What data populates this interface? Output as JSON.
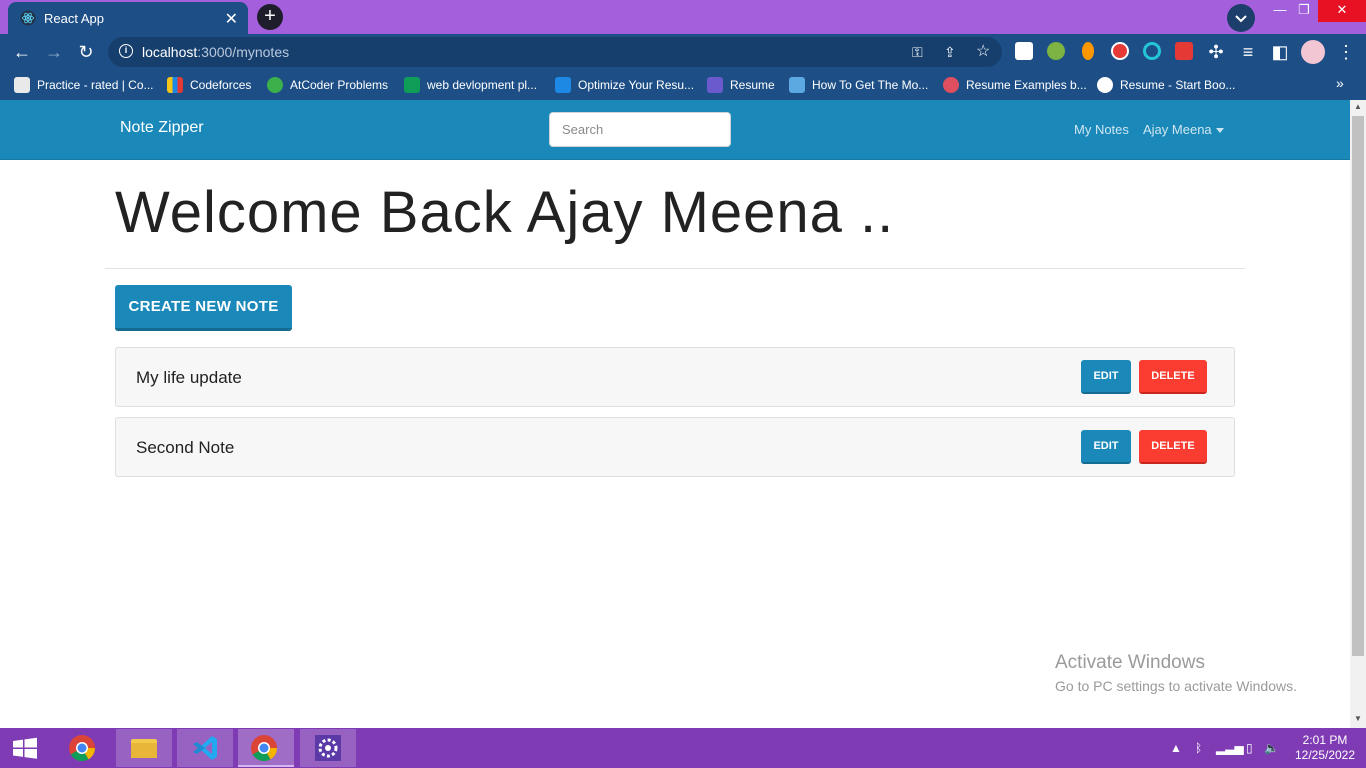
{
  "browser": {
    "tab_title": "React App",
    "url_host": "localhost",
    "url_path": ":3000/mynotes",
    "bookmarks": [
      {
        "label": "Practice - rated | Co...",
        "icon": "cc-icon",
        "color": "#e9e9e9"
      },
      {
        "label": "Codeforces",
        "icon": "codeforces-icon",
        "color": "#f5c518"
      },
      {
        "label": "AtCoder Problems",
        "icon": "atcoder-icon",
        "color": "#3cb04a"
      },
      {
        "label": "web devlopment pl...",
        "icon": "sheets-icon",
        "color": "#0f9d58"
      },
      {
        "label": "Optimize Your Resu...",
        "icon": "tie-icon",
        "color": "#1e88e5"
      },
      {
        "label": "Resume",
        "icon": "code-icon",
        "color": "#6a5acd"
      },
      {
        "label": "How To Get The Mo...",
        "icon": "layers-icon",
        "color": "#5ba9e0"
      },
      {
        "label": "Resume Examples b...",
        "icon": "swirl-icon",
        "color": "#e04f5f"
      },
      {
        "label": "Resume - Start Boo...",
        "icon": "globe-icon",
        "color": "#ffffff"
      }
    ]
  },
  "app": {
    "brand": "Note Zipper",
    "search_placeholder": "Search",
    "nav_my_notes": "My Notes",
    "nav_user": "Ajay Meena",
    "welcome": "Welcome Back Ajay Meena ..",
    "create_button": "CREATE NEW NOTE",
    "notes": [
      {
        "title": "My life update",
        "edit": "EDIT",
        "delete": "DELETE"
      },
      {
        "title": "Second Note",
        "edit": "EDIT",
        "delete": "DELETE"
      }
    ],
    "colors": {
      "primary": "#1a89b9",
      "danger": "#fa3c31"
    }
  },
  "watermark": {
    "line1": "Activate Windows",
    "line2": "Go to PC settings to activate Windows."
  },
  "taskbar": {
    "time": "2:01 PM",
    "date": "12/25/2022"
  }
}
